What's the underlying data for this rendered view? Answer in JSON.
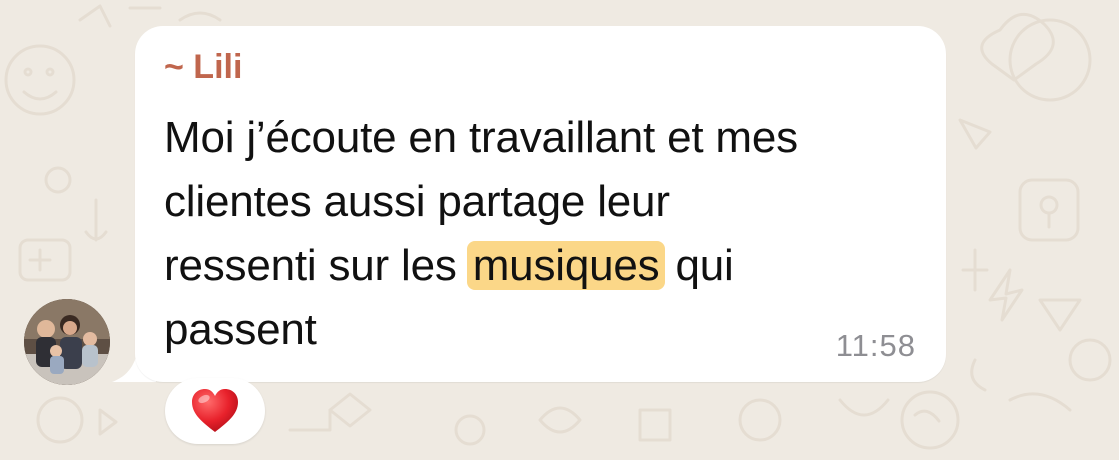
{
  "message": {
    "sender": "~ Lili",
    "lines": [
      "Moi j’écoute en travaillant et mes",
      "clientes aussi partage leur"
    ],
    "line3_before": "ressenti sur les ",
    "line3_highlight": "musiques",
    "line3_after": " qui",
    "line4": "passent",
    "time": "11:58"
  },
  "reaction": {
    "icon": "red-heart-icon",
    "emoji": "❤️"
  },
  "avatar": {
    "icon": "profile-photo"
  },
  "colors": {
    "background": "#efeae2",
    "bubble": "#ffffff",
    "sender_name": "#c0664d",
    "highlight": "#fbd788",
    "timestamp": "#8e8e93"
  }
}
